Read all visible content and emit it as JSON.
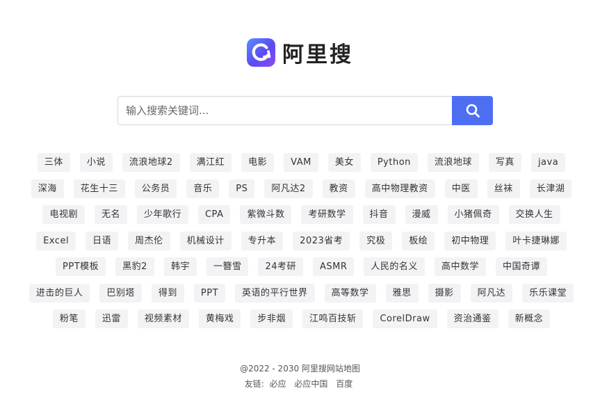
{
  "brand": {
    "name": "阿里搜",
    "icon": "refresh-logo-icon"
  },
  "search": {
    "placeholder": "输入搜索关键词...",
    "value": "",
    "button_icon": "search-icon",
    "button_color": "#4e6ef2"
  },
  "tag_rows": [
    [
      "三体",
      "小说",
      "流浪地球2",
      "满江红",
      "电影",
      "VAM",
      "美女",
      "Python",
      "流浪地球",
      "写真",
      "java"
    ],
    [
      "深海",
      "花生十三",
      "公务员",
      "音乐",
      "PS",
      "阿凡达2",
      "教资",
      "高中物理教资",
      "中医",
      "丝袜",
      "长津湖"
    ],
    [
      "电视剧",
      "无名",
      "少年歌行",
      "CPA",
      "紫微斗数",
      "考研数学",
      "抖音",
      "漫威",
      "小猪佩奇",
      "交换人生"
    ],
    [
      "Excel",
      "日语",
      "周杰伦",
      "机械设计",
      "专升本",
      "2023省考",
      "究极",
      "板绘",
      "初中物理",
      "叶卡捷琳娜"
    ],
    [
      "PPT模板",
      "黑豹2",
      "韩宇",
      "一簪雪",
      "24考研",
      "ASMR",
      "人民的名义",
      "高中数学",
      "中国奇谭"
    ],
    [
      "进击的巨人",
      "巴别塔",
      "得到",
      "PPT",
      "英语的平行世界",
      "高等数学",
      "雅思",
      "摄影",
      "阿凡达",
      "乐乐课堂"
    ],
    [
      "粉笔",
      "迅雷",
      "视频素材",
      "黄梅戏",
      "步非烟",
      "江鸣百技斩",
      "CorelDraw",
      "资治通鉴",
      "新概念"
    ]
  ],
  "footer": {
    "copyright": "@2022 - 2030 阿里搜网站地图",
    "friends_label": "友链:",
    "friend_links": [
      "必应",
      "必应中国",
      "百度"
    ]
  }
}
